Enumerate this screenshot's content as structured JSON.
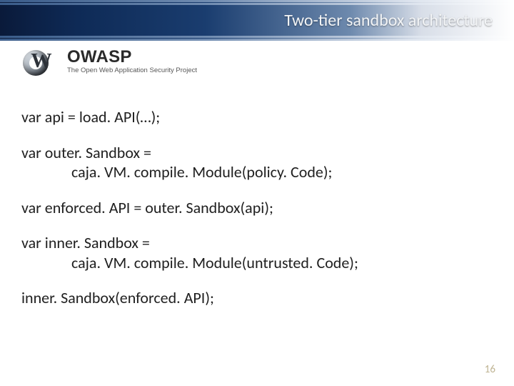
{
  "slide": {
    "title": "Two-tier sandbox architecture",
    "page_number": "16"
  },
  "logo": {
    "name": "OWASP",
    "tagline": "The Open Web Application Security Project"
  },
  "code": {
    "line1": "var api = load. API(…);",
    "line2a": "var outer. Sandbox =",
    "line2b": "caja. VM. compile. Module(policy. Code);",
    "line3": "var enforced. API = outer. Sandbox(api);",
    "line4a": "var inner. Sandbox   =",
    "line4b": "caja. VM. compile. Module(untrusted. Code);",
    "line5": "inner. Sandbox(enforced. API);"
  }
}
